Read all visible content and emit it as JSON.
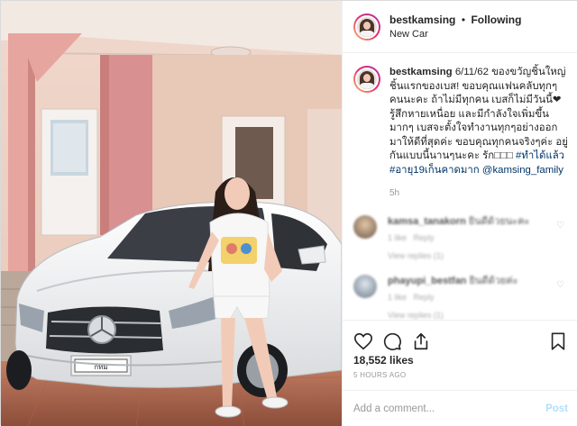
{
  "photo": {
    "alt_plate": "กทม"
  },
  "header": {
    "username": "bestkamsing",
    "separator": "•",
    "follow_label": "Following",
    "location": "New Car"
  },
  "caption": {
    "username": "bestkamsing",
    "text_1": "6/11/62 ของขวัญชิ้นใหญ่ชิ้นแรกของเบส!",
    "text_2": " ขอบคุณแฟนคลับทุกๆคนนะคะ ถ้าไม่มีทุกคน เบสก็ไม่มีวันนี้❤ รู้สึกหายเหนื่อย และมีกำลังใจเพิ่มขึ้นมากๆ เบสจะตั้งใจทำงานทุกๆอย่างออกมาให้ดีที่สุดค่ะ ขอบคุณทุกคนจริงๆค่ะ อยู่กันแบบนี้นานๆนะคะ รัก□□□ ",
    "hashtag_1": "#ทำได้แล้ว",
    "hashtag_2": "#อายุ19เก็นคาดมาก",
    "mention": "@kamsing_family",
    "time": "5h"
  },
  "comments": [
    {
      "user": "kamsa_tanakorn",
      "text": "ยินดีด้วยนะคะ",
      "meta_1": "1 like",
      "meta_2": "Reply",
      "replies": "View replies (1)"
    },
    {
      "user": "phayupi_bestfan",
      "text": "ยินดีด้วยค่ะ",
      "meta_1": "1 like",
      "meta_2": "Reply",
      "replies": "View replies (1)"
    }
  ],
  "stats": {
    "likes": "18,552 likes",
    "time": "5 HOURS AGO"
  },
  "add_comment": {
    "placeholder": "Add a comment...",
    "post_label": "Post"
  },
  "icons": {
    "like": "heart-icon",
    "comment": "comment-icon",
    "share": "share-icon",
    "save": "bookmark-icon"
  },
  "colors": {
    "link": "#003569",
    "post_button_disabled": "#b2dffc",
    "muted": "#999999"
  }
}
